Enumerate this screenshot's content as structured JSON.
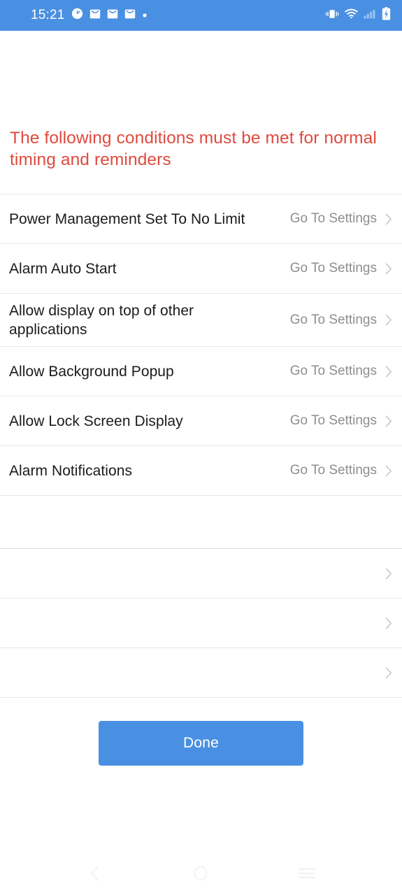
{
  "status_bar": {
    "clock": "15:21",
    "background_color": "#4a90e2",
    "left_icons": [
      "clock-icon",
      "mail-icon",
      "mail-icon",
      "mail-icon",
      "dot-icon"
    ],
    "right_icons": [
      "vibrate-icon",
      "wifi-icon",
      "signal-icon",
      "battery-charging-icon"
    ]
  },
  "header": {
    "message": "The following conditions must be met for normal timing and reminders",
    "color": "#e04a3f"
  },
  "list": {
    "action_label": "Go To Settings",
    "rows": [
      {
        "label": "Power Management Set To No Limit",
        "action": "Go To Settings",
        "chevron": true
      },
      {
        "label": "Alarm Auto Start",
        "action": "Go To Settings",
        "chevron": true
      },
      {
        "label": "Allow display on top of other applications",
        "action": "Go To Settings",
        "chevron": true
      },
      {
        "label": "Allow Background Popup",
        "action": "Go To Settings",
        "chevron": true
      },
      {
        "label": "Allow Lock Screen Display",
        "action": "Go To Settings",
        "chevron": true
      },
      {
        "label": "Alarm Notifications",
        "action": "Go To Settings",
        "chevron": true
      },
      {
        "label": "",
        "action": "",
        "chevron": false
      },
      {
        "label": "",
        "action": "",
        "chevron": true
      },
      {
        "label": "",
        "action": "",
        "chevron": true
      },
      {
        "label": "",
        "action": "",
        "chevron": true
      }
    ]
  },
  "footer": {
    "done_label": "Done",
    "done_color": "#4a90e2"
  },
  "nav_bar": {
    "back": "back-icon",
    "home": "home-icon",
    "recents": "recents-icon"
  }
}
